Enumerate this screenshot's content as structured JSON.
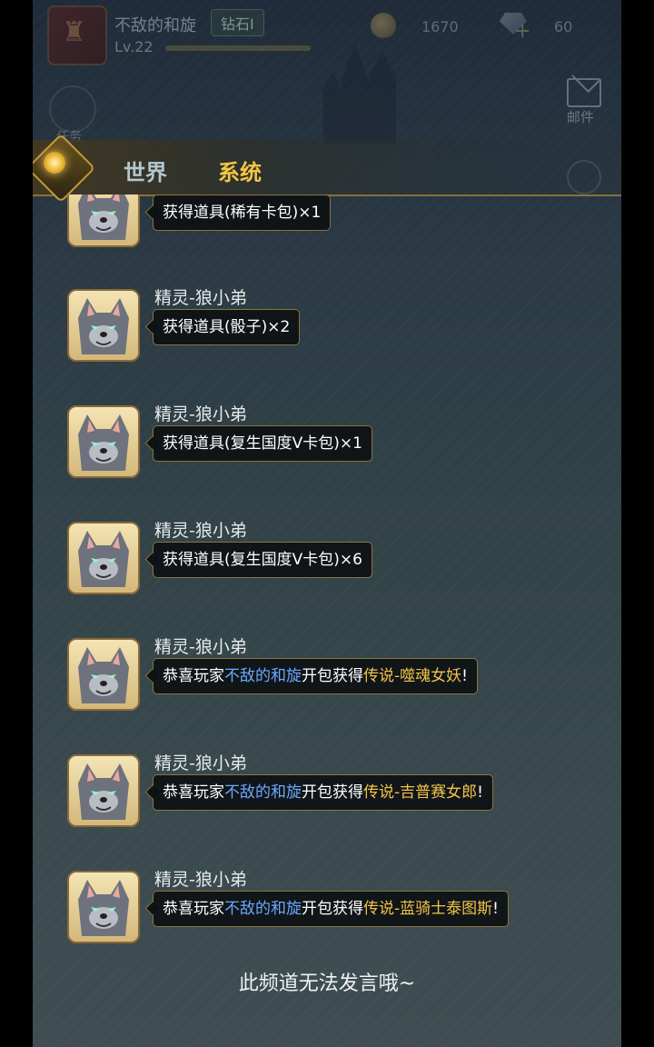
{
  "header": {
    "player_name": "不敌的和旋",
    "rank": "钻石Ⅰ",
    "level": "Lv.22",
    "coins": "1670",
    "gems": "60",
    "mail_label": "邮件",
    "left_icon_label": "任务"
  },
  "tabs": {
    "world": "世界",
    "system": "系统",
    "active": "系统"
  },
  "messages": [
    {
      "sender": "",
      "text": "获得道具(稀有卡包)×1",
      "parts": []
    },
    {
      "sender": "精灵-狼小弟",
      "text": "获得道具(骰子)×2",
      "parts": []
    },
    {
      "sender": "精灵-狼小弟",
      "text": "获得道具(复生国度V卡包)×1",
      "parts": []
    },
    {
      "sender": "精灵-狼小弟",
      "text": "获得道具(复生国度V卡包)×6",
      "parts": []
    },
    {
      "sender": "精灵-狼小弟",
      "parts": [
        {
          "t": "恭喜玩家",
          "c": ""
        },
        {
          "t": "不敌的和旋",
          "c": "blue"
        },
        {
          "t": "开包获得",
          "c": ""
        },
        {
          "t": "传说-噬魂女妖",
          "c": "gold"
        },
        {
          "t": "!",
          "c": ""
        }
      ]
    },
    {
      "sender": "精灵-狼小弟",
      "parts": [
        {
          "t": "恭喜玩家",
          "c": ""
        },
        {
          "t": "不敌的和旋",
          "c": "blue"
        },
        {
          "t": "开包获得",
          "c": ""
        },
        {
          "t": "传说-吉普赛女郎",
          "c": "gold"
        },
        {
          "t": "!",
          "c": ""
        }
      ]
    },
    {
      "sender": "精灵-狼小弟",
      "parts": [
        {
          "t": "恭喜玩家",
          "c": ""
        },
        {
          "t": "不敌的和旋",
          "c": "blue"
        },
        {
          "t": "开包获得",
          "c": ""
        },
        {
          "t": "传说-蓝骑士泰图斯",
          "c": "gold"
        },
        {
          "t": "!",
          "c": ""
        }
      ]
    }
  ],
  "notice": "此频道无法发言哦~",
  "colors": {
    "highlight_player": "#6ea8ff",
    "highlight_card": "#f3c44a",
    "tab_active": "#f2c640"
  }
}
